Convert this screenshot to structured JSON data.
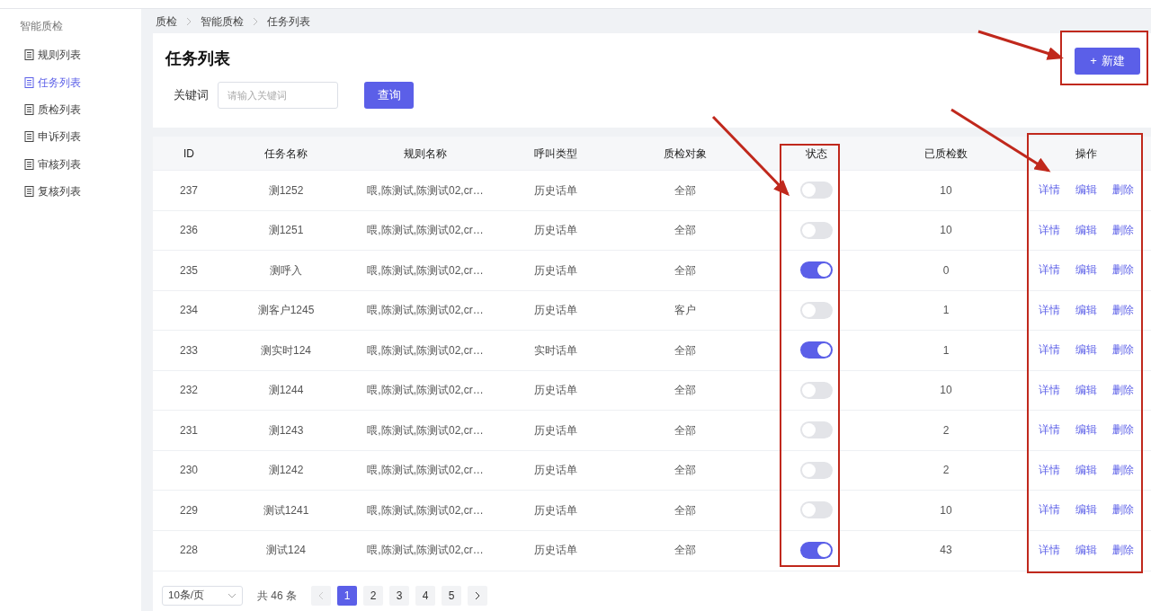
{
  "sidebar": {
    "title": "智能质检",
    "items": [
      {
        "label": "规则列表",
        "selected": false
      },
      {
        "label": "任务列表",
        "selected": true
      },
      {
        "label": "质检列表",
        "selected": false
      },
      {
        "label": "申诉列表",
        "selected": false
      },
      {
        "label": "审核列表",
        "selected": false
      },
      {
        "label": "复核列表",
        "selected": false
      }
    ]
  },
  "breadcrumb": [
    "质检",
    "智能质检",
    "任务列表"
  ],
  "page_title": "任务列表",
  "filter": {
    "label": "关键词",
    "placeholder": "请输入关键词",
    "button": "查询"
  },
  "new_button": {
    "icon": "+",
    "label": "新建"
  },
  "table": {
    "columns": [
      "ID",
      "任务名称",
      "规则名称",
      "呼叫类型",
      "质检对象",
      "状态",
      "已质检数",
      "操作"
    ],
    "rows": [
      {
        "id": "237",
        "name": "测1252",
        "rules": "喂,陈测试,陈测试02,cr…",
        "call_type": "历史话单",
        "target": "全部",
        "on": false,
        "count": "10",
        "actions": [
          "详情",
          "编辑",
          "删除"
        ]
      },
      {
        "id": "236",
        "name": "测1251",
        "rules": "喂,陈测试,陈测试02,cr…",
        "call_type": "历史话单",
        "target": "全部",
        "on": false,
        "count": "10",
        "actions": [
          "详情",
          "编辑",
          "删除"
        ]
      },
      {
        "id": "235",
        "name": "测呼入",
        "rules": "喂,陈测试,陈测试02,cr…",
        "call_type": "历史话单",
        "target": "全部",
        "on": true,
        "count": "0",
        "actions": [
          "详情",
          "编辑",
          "删除"
        ]
      },
      {
        "id": "234",
        "name": "测客户1245",
        "rules": "喂,陈测试,陈测试02,cr…",
        "call_type": "历史话单",
        "target": "客户",
        "on": false,
        "count": "1",
        "actions": [
          "详情",
          "编辑",
          "删除"
        ]
      },
      {
        "id": "233",
        "name": "测实时124",
        "rules": "喂,陈测试,陈测试02,cr…",
        "call_type": "实时话单",
        "target": "全部",
        "on": true,
        "count": "1",
        "actions": [
          "详情",
          "编辑",
          "删除"
        ]
      },
      {
        "id": "232",
        "name": "测1244",
        "rules": "喂,陈测试,陈测试02,cr…",
        "call_type": "历史话单",
        "target": "全部",
        "on": false,
        "count": "10",
        "actions": [
          "详情",
          "编辑",
          "删除"
        ]
      },
      {
        "id": "231",
        "name": "测1243",
        "rules": "喂,陈测试,陈测试02,cr…",
        "call_type": "历史话单",
        "target": "全部",
        "on": false,
        "count": "2",
        "actions": [
          "详情",
          "编辑",
          "删除"
        ]
      },
      {
        "id": "230",
        "name": "测1242",
        "rules": "喂,陈测试,陈测试02,cr…",
        "call_type": "历史话单",
        "target": "全部",
        "on": false,
        "count": "2",
        "actions": [
          "详情",
          "编辑",
          "删除"
        ]
      },
      {
        "id": "229",
        "name": "测试1241",
        "rules": "喂,陈测试,陈测试02,cr…",
        "call_type": "历史话单",
        "target": "全部",
        "on": false,
        "count": "10",
        "actions": [
          "详情",
          "编辑",
          "删除"
        ]
      },
      {
        "id": "228",
        "name": "测试124",
        "rules": "喂,陈测试,陈测试02,cr…",
        "call_type": "历史话单",
        "target": "全部",
        "on": true,
        "count": "43",
        "actions": [
          "详情",
          "编辑",
          "删除"
        ]
      }
    ]
  },
  "pagination": {
    "page_size": "10条/页",
    "total": "共 46 条",
    "prev_disabled": true,
    "next_disabled": false,
    "pages": [
      {
        "label": "1",
        "selected": true
      },
      {
        "label": "2",
        "selected": false
      },
      {
        "label": "3",
        "selected": false
      },
      {
        "label": "4",
        "selected": false
      },
      {
        "label": "5",
        "selected": false
      }
    ]
  }
}
